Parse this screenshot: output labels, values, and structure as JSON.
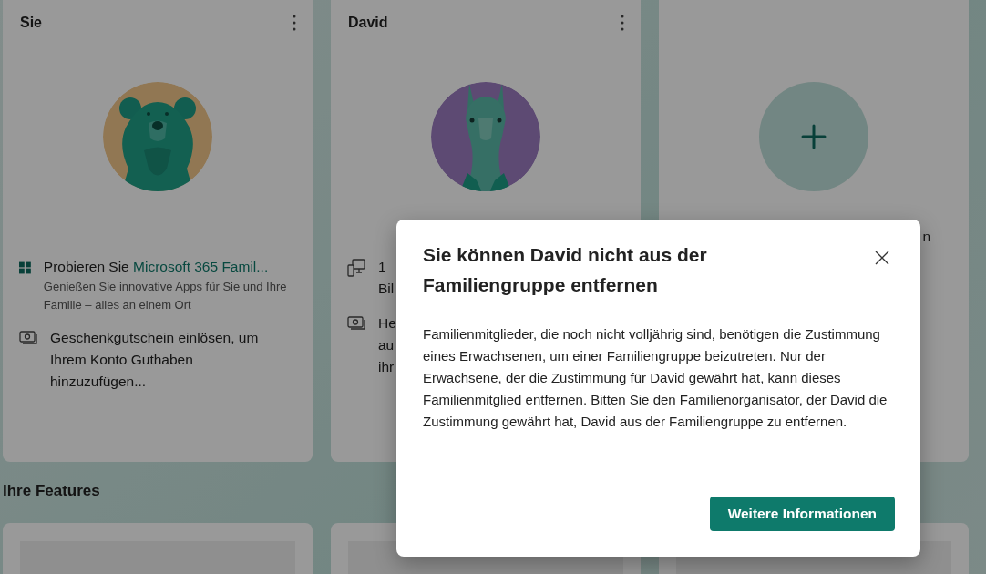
{
  "members": [
    {
      "kind": "member",
      "name": "Sie",
      "avatar": {
        "kind": "bear"
      },
      "items": [
        {
          "kind": "promo",
          "prefix": "Probieren Sie ",
          "link": "Microsoft 365 Famil...",
          "subtitle": "Genießen Sie innovative Apps für Sie und Ihre Familie – alles an einem Ort"
        },
        {
          "kind": "gift",
          "lines": [
            "Geschenkgutschein einlösen, um",
            "Ihrem Konto Guthaben",
            "hinzuzufügen..."
          ]
        }
      ]
    },
    {
      "kind": "member",
      "name": "David",
      "avatar": {
        "kind": "llama"
      },
      "items": [
        {
          "kind": "device",
          "lines": [
            "1",
            "Bil"
          ]
        },
        {
          "kind": "gift",
          "lines": [
            "He",
            "au",
            "ihr"
          ]
        }
      ]
    },
    {
      "kind": "add",
      "lines": [
        "n"
      ]
    }
  ],
  "features_heading": "Ihre Features",
  "dialog": {
    "title": "Sie können David nicht aus der Familiengruppe entfernen",
    "body": "Familienmitglieder, die noch nicht volljährig sind, benötigen die Zustimmung eines Erwachsenen, um einer Familiengruppe beizutreten. Nur der Erwachsene, der die Zustimmung für David gewährt hat, kann dieses Familienmitglied entfernen. Bitten Sie den Familienorganisator, der David die Zustimmung gewährt hat, David aus der Familiengruppe zu entfernen.",
    "button": "Weitere Informationen"
  }
}
